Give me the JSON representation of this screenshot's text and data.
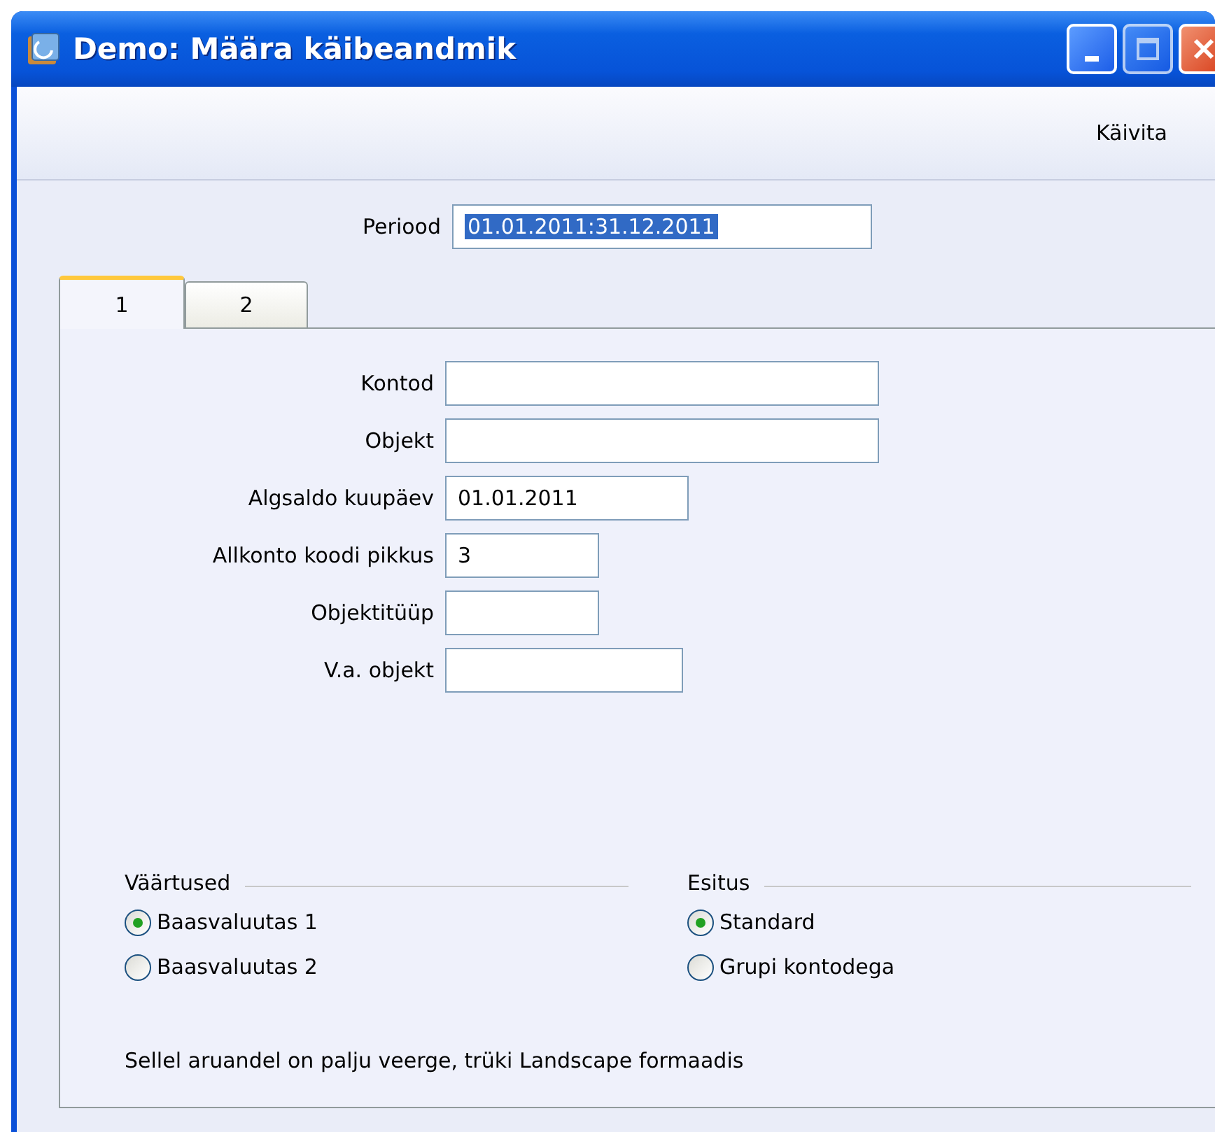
{
  "window": {
    "title": "Demo: Määra käibeandmik"
  },
  "toolbar": {
    "actions": [
      {
        "label": "Käivita"
      }
    ]
  },
  "period": {
    "label": "Periood",
    "value": "01.01.2011:31.12.2011",
    "highlighted": true
  },
  "tabs": [
    {
      "label": "1",
      "selected": true
    },
    {
      "label": "2",
      "selected": false
    }
  ],
  "fields": [
    {
      "label": "Kontod"
    },
    {
      "label": "Objekt"
    },
    {
      "label": "Algsaldo kuupäev",
      "value": "01.01.2011"
    },
    {
      "label": "Allkonto koodi pikkus",
      "value": "3"
    },
    {
      "label": "Objektitüüp"
    },
    {
      "label": "V.a. objekt"
    }
  ],
  "groups": [
    {
      "title": "Väärtused",
      "options": [
        {
          "label": "Baasvaluutas 1",
          "selected": true
        },
        {
          "label": "Baasvaluutas 2",
          "selected": false
        }
      ]
    },
    {
      "title": "Esitus",
      "options": [
        {
          "label": "Standard",
          "selected": true
        },
        {
          "label": "Grupi kontodega",
          "selected": false
        }
      ]
    }
  ],
  "note": "Sellel aruandel on palju veerge, trüki Landscape formaadis"
}
